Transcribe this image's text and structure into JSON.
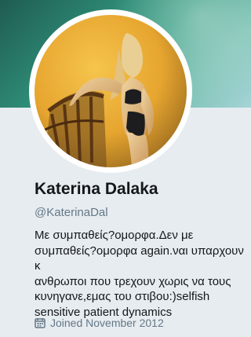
{
  "profile": {
    "name": "Katerina Dalaka",
    "handle": "@KaterinaDal",
    "bio": "Με συμπαθείς?ομορφα.Δεν με\nσυμπαθείς?ομορφα again.ναι υπαρχουν κ\nανθρωποι που τρεχουν χωρις να τους\nκυνηγανε,εμας του στιβου:)selfish\nsensitive patient dynamics",
    "joined": "Joined November 2012",
    "joined_icon": "calendar-icon"
  },
  "colors": {
    "page_background": "#e6ecf0",
    "name": "#14171a",
    "secondary_text": "#657786",
    "banner": "#3b9f86"
  }
}
